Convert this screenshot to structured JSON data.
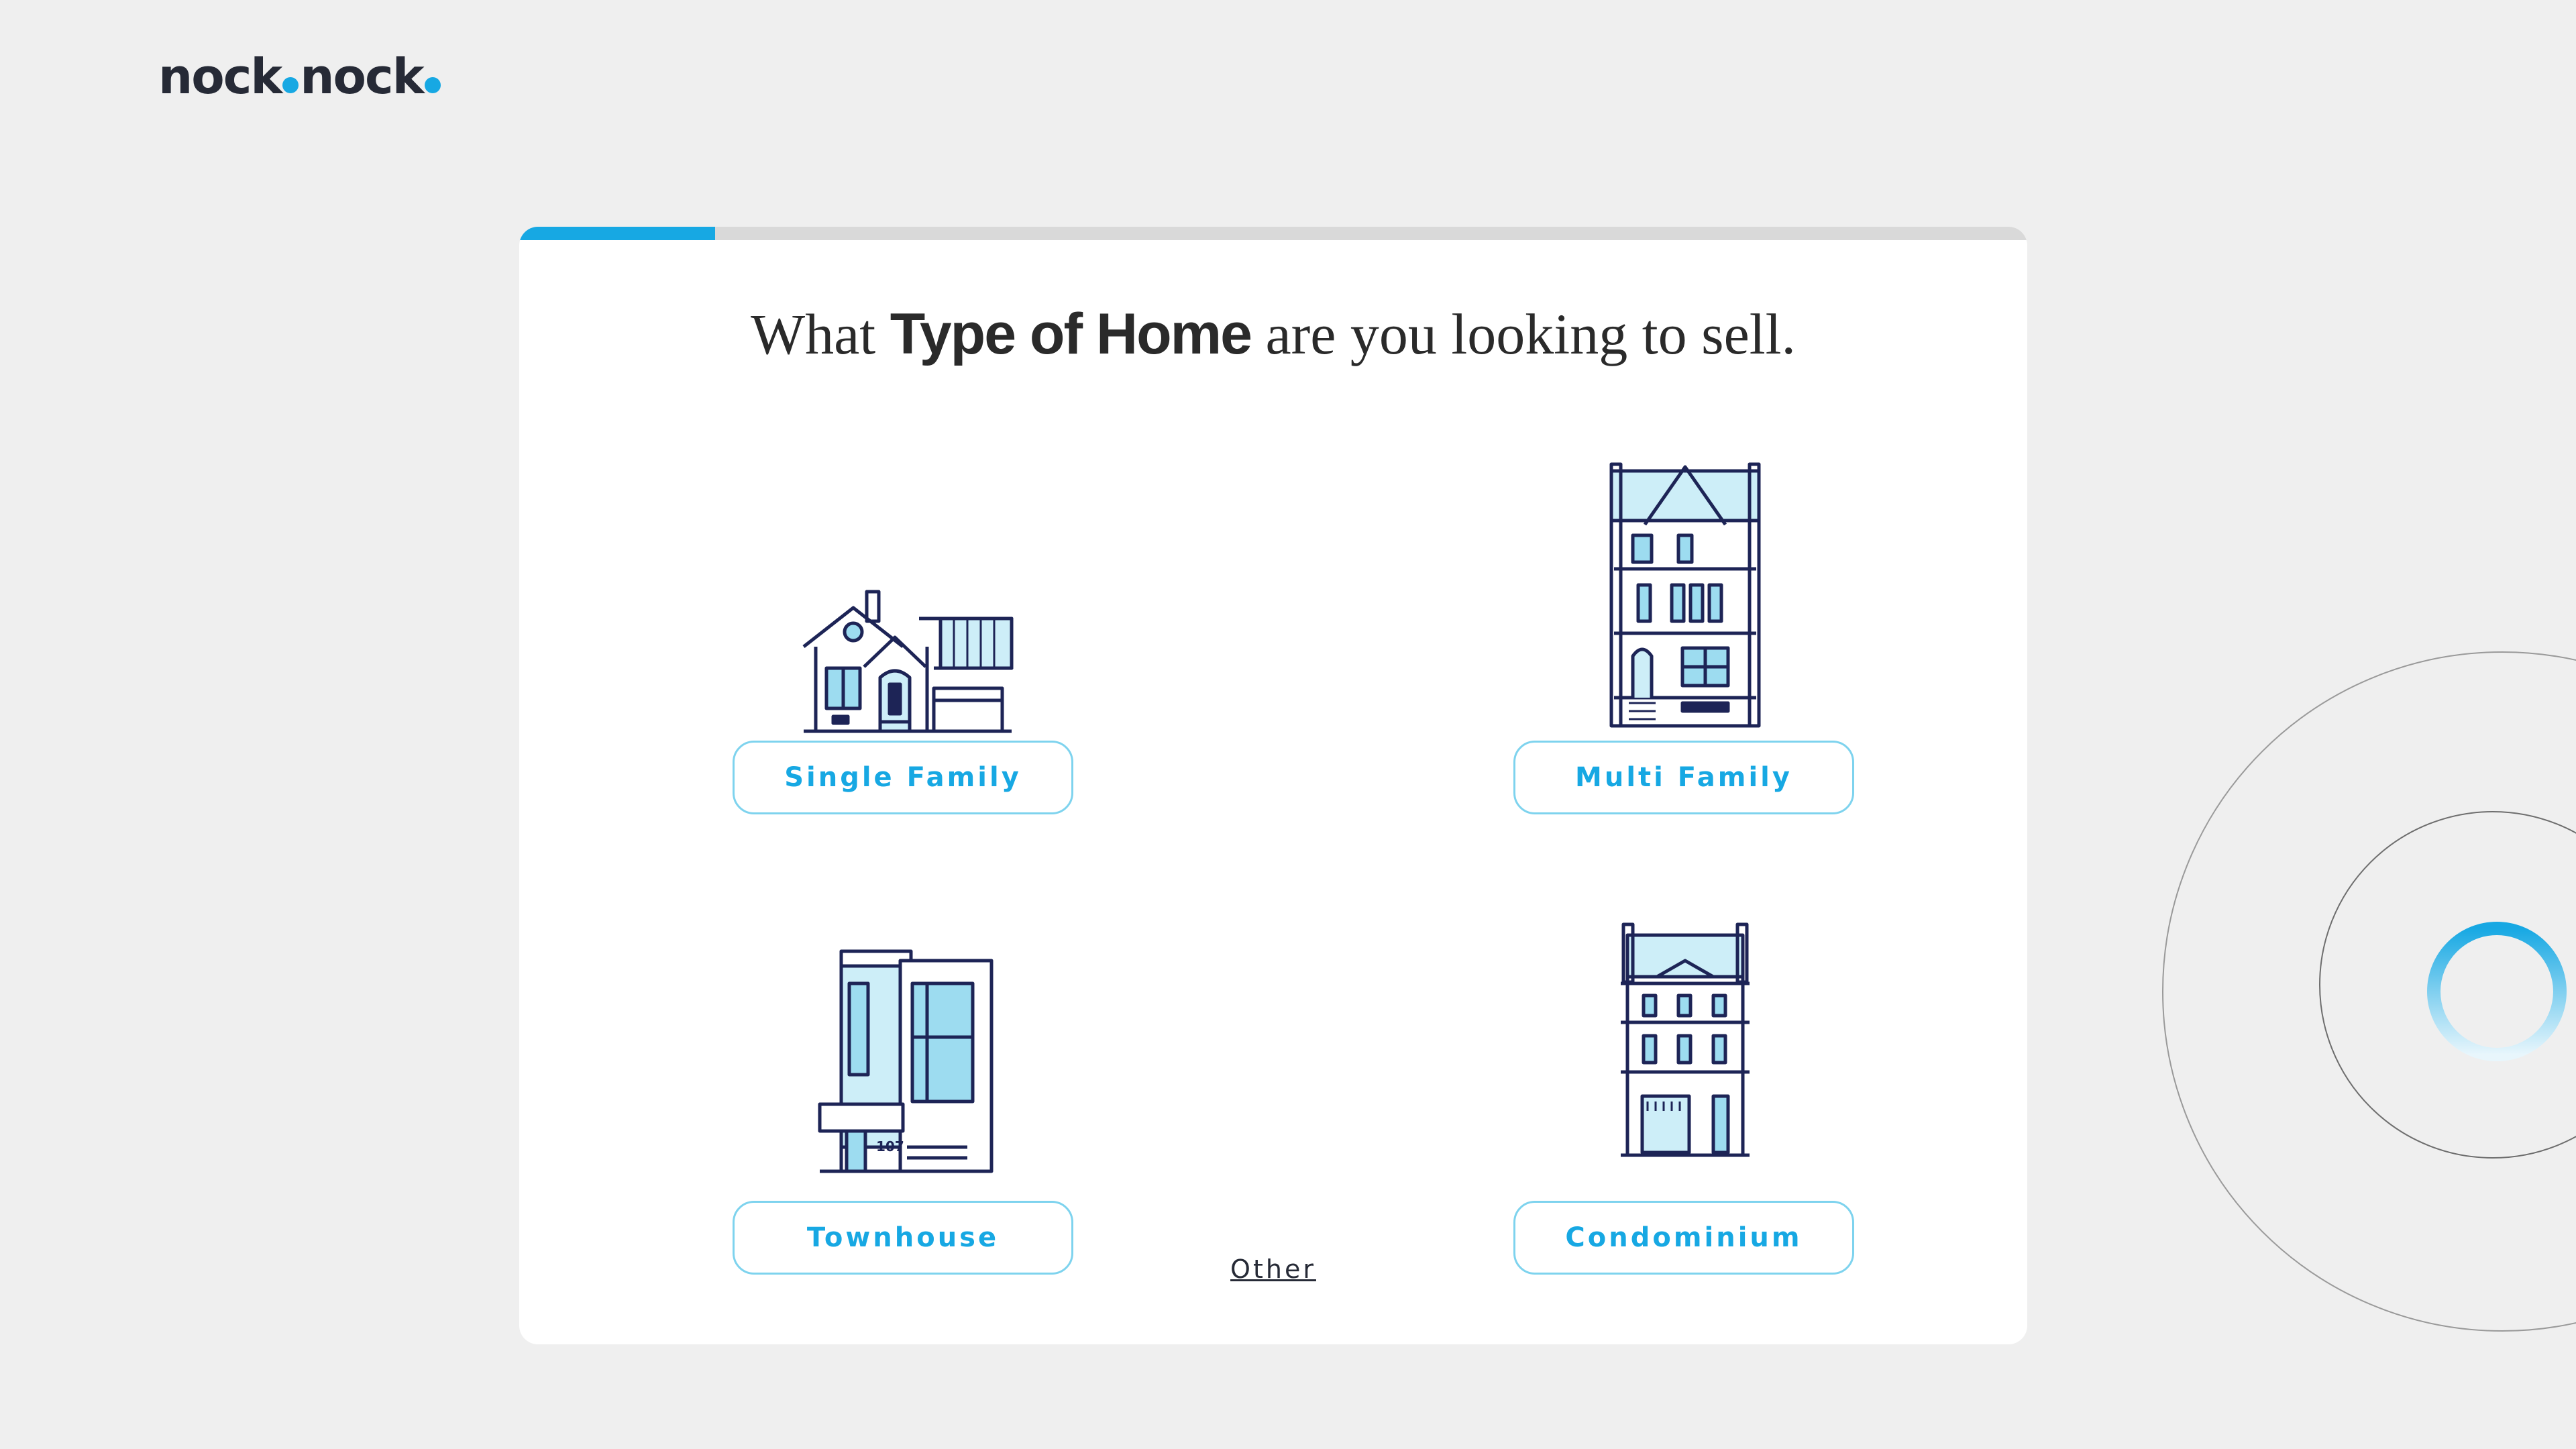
{
  "brand": {
    "logo_part1": "nock",
    "logo_part2": "nock",
    "accent": "#17a8e3",
    "ink": "#262a36"
  },
  "progress": {
    "fraction": 0.13
  },
  "question": {
    "prefix": "What ",
    "emphasis": "Type of Home",
    "suffix": " are you looking to sell."
  },
  "options": [
    {
      "label": "Single Family",
      "icon": "single-family-house-icon"
    },
    {
      "label": "Multi Family",
      "icon": "multi-family-building-icon"
    },
    {
      "label": "Townhouse",
      "icon": "townhouse-icon",
      "house_number": "107"
    },
    {
      "label": "Condominium",
      "icon": "condominium-building-icon"
    }
  ],
  "other_link": "Other",
  "loading_spinner": {
    "icon": "loading-spinner-icon"
  }
}
